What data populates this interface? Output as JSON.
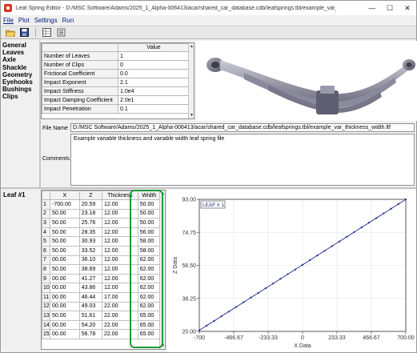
{
  "window": {
    "title": "Leaf Spring Editor - D:/MSC Software/Adams/2025_1_Alpha-006413/acar/shared_car_database.cdb/leafsprings.tbl/example_var_thickness_width.ltf",
    "minimize": "—",
    "maximize": "☐",
    "close": "✕"
  },
  "menu": [
    "File",
    "Plot",
    "Settings",
    "Run"
  ],
  "toolbar": [
    {
      "icon": "open-folder-icon"
    },
    {
      "icon": "save-icon"
    },
    {
      "icon": "table-icon"
    },
    {
      "icon": "properties-icon"
    }
  ],
  "nav": [
    "General",
    "Leaves",
    "Axle",
    "Shackle",
    "Geometry",
    "Eyehooks",
    "Bushings",
    "Clips"
  ],
  "props": {
    "header_value": "Value",
    "rows": [
      {
        "name": "Number of Leaves",
        "value": "1"
      },
      {
        "name": "Number of Clips",
        "value": "0"
      },
      {
        "name": "Frictional Coefficient",
        "value": "0.0"
      },
      {
        "name": "Impact Exponent",
        "value": "2.1"
      },
      {
        "name": "Impact Stiffness",
        "value": "1.0e4"
      },
      {
        "name": "Impact Damping Coefficient",
        "value": "2.0e1"
      },
      {
        "name": "Impact Penetration",
        "value": "0.1"
      }
    ]
  },
  "file": {
    "label": "File Name",
    "value": "D:/MSC Software/Adams/2025_1_Alpha-006413/acar/shared_car_database.cdb/leafsprings.tbl/example_var_thickness_width.ltf"
  },
  "comments": {
    "label": "Comments",
    "value": "Example variable thickness and variable width leaf spring file"
  },
  "leaf": {
    "label": "Leaf #1",
    "columns": [
      "X",
      "Z",
      "Thickness",
      "Width"
    ],
    "rows": [
      {
        "n": "1",
        "x": "-700.00",
        "z": "20.59",
        "t": "12.00",
        "w": "50.00"
      },
      {
        "n": "2",
        "x": "50.00",
        "z": "23.18",
        "t": "12.00",
        "w": "50.00"
      },
      {
        "n": "3",
        "x": "50.00",
        "z": "25.76",
        "t": "12.00",
        "w": "50.00"
      },
      {
        "n": "4",
        "x": "50.00",
        "z": "28.35",
        "t": "12.00",
        "w": "56.00"
      },
      {
        "n": "5",
        "x": "50.00",
        "z": "30.93",
        "t": "12.00",
        "w": "58.00"
      },
      {
        "n": "6",
        "x": "50.00",
        "z": "33.52",
        "t": "12.00",
        "w": "58.00"
      },
      {
        "n": "7",
        "x": "00.00",
        "z": "36.10",
        "t": "12.00",
        "w": "62.00"
      },
      {
        "n": "8",
        "x": "50.00",
        "z": "38.69",
        "t": "12.00",
        "w": "62.00"
      },
      {
        "n": "9",
        "x": "00.00",
        "z": "41.27",
        "t": "12.00",
        "w": "62.00"
      },
      {
        "n": "10",
        "x": "00.00",
        "z": "43.86",
        "t": "12.00",
        "w": "62.00"
      },
      {
        "n": "11",
        "x": "00.00",
        "z": "46.44",
        "t": "17.00",
        "w": "62.00"
      },
      {
        "n": "12",
        "x": "00.00",
        "z": "49.03",
        "t": "22.00",
        "w": "62.00"
      },
      {
        "n": "13",
        "x": "50.00",
        "z": "51.61",
        "t": "22.00",
        "w": "65.00"
      },
      {
        "n": "14",
        "x": "00.00",
        "z": "54.20",
        "t": "22.00",
        "w": "65.00"
      },
      {
        "n": "15",
        "x": "00.00",
        "z": "56.78",
        "t": "22.00",
        "w": "65.00"
      }
    ]
  },
  "chart_data": {
    "type": "line",
    "title": "LEAF # 1",
    "xlabel": "X Data",
    "ylabel": "Z Data",
    "xlim": [
      -700,
      700
    ],
    "ylim": [
      20,
      93
    ],
    "xticks": [
      "-700",
      "-466.67",
      "-233.33",
      "0",
      "233.33",
      "466.67",
      "700.00"
    ],
    "yticks": [
      "20.00",
      "38.25",
      "56.50",
      "74.75",
      "93.00"
    ],
    "x": [
      -700,
      -650,
      -600,
      -550,
      -500,
      -450,
      -400,
      -350,
      -300,
      -250,
      -200,
      -150,
      -100,
      -50,
      0,
      50,
      100,
      150,
      200,
      250,
      300,
      350,
      400,
      450,
      500,
      550,
      600,
      650,
      700
    ],
    "y": [
      20.59,
      23.18,
      25.76,
      28.35,
      30.93,
      33.52,
      36.1,
      38.69,
      41.27,
      43.86,
      46.44,
      49.03,
      51.61,
      54.2,
      56.78,
      59.37,
      61.95,
      64.54,
      67.12,
      69.71,
      72.29,
      74.88,
      77.46,
      80.05,
      82.63,
      85.22,
      87.8,
      90.39,
      92.97
    ],
    "color": "#1a2a8a"
  },
  "colors": {
    "highlight": "#1e9a3a",
    "menu_text": "#001a80"
  }
}
